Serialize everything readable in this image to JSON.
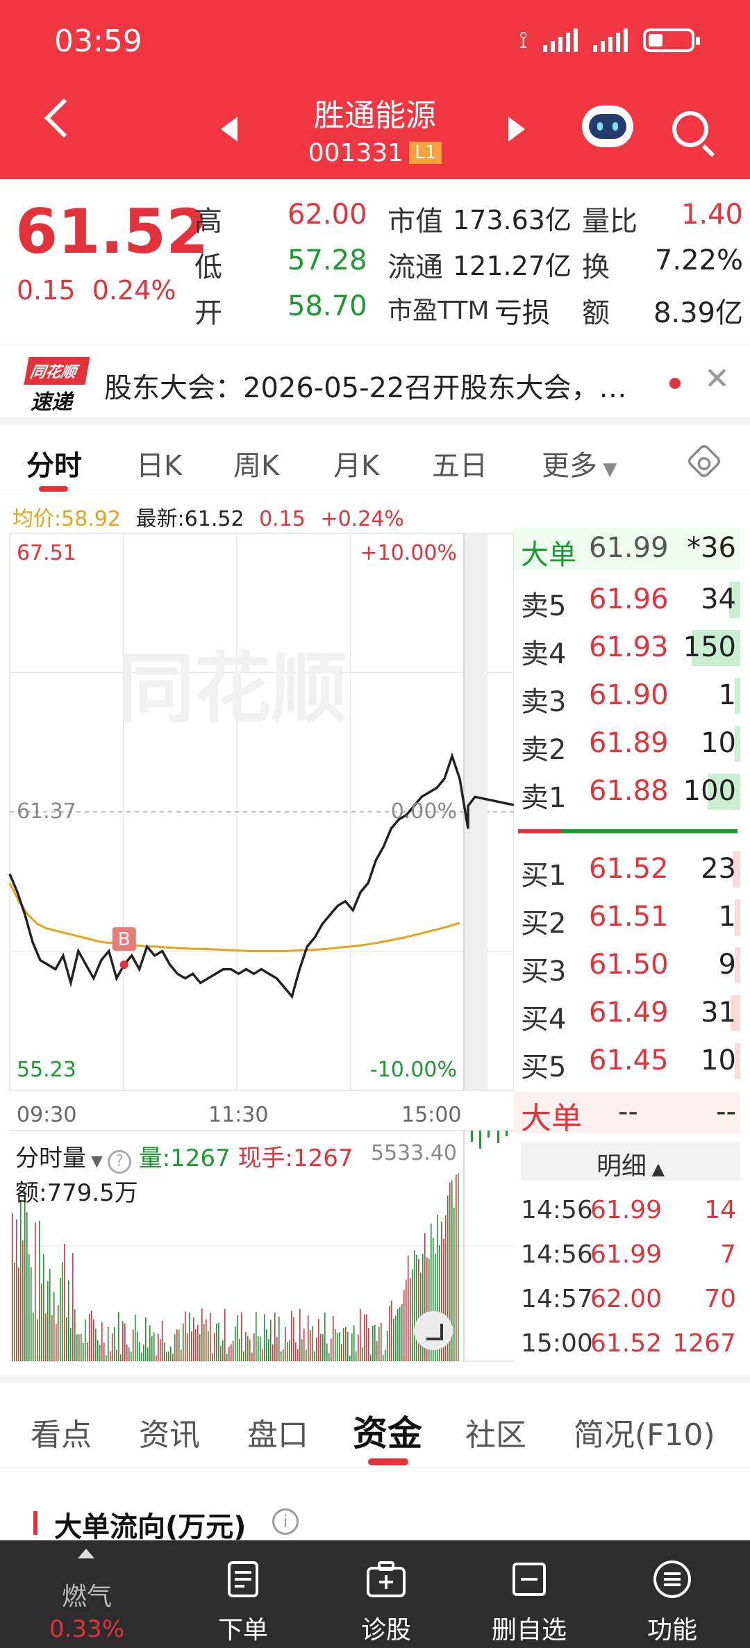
{
  "status": {
    "time": "03:59"
  },
  "header": {
    "stock_name": "胜通能源",
    "stock_code": "001331",
    "level_badge": "L1"
  },
  "quote": {
    "last_price": "61.52",
    "change": "0.15",
    "change_pct": "0.24%",
    "high_label": "高",
    "high": "62.00",
    "low_label": "低",
    "low": "57.28",
    "open_label": "开",
    "open": "58.70",
    "mcap_label": "市值",
    "mcap": "173.63亿",
    "float_label": "流通",
    "float": "121.27亿",
    "pe_label": "市盈TTM",
    "pe": "亏损",
    "vol_ratio_label": "量比",
    "vol_ratio": "1.40",
    "turnover_label": "换",
    "turnover": "7.22%",
    "amount_label": "额",
    "amount": "8.39亿"
  },
  "announcement": {
    "logo_top": "同花顺",
    "logo_bottom": "速递",
    "text": "股东大会：2026-05-22召开股东大会，…"
  },
  "period_tabs": [
    "分时",
    "日K",
    "周K",
    "月K",
    "五日",
    "更多"
  ],
  "chart_info": {
    "avg": "均价:58.92",
    "latest": "最新:61.52",
    "chg": "0.15",
    "chg_pct": "+0.24%"
  },
  "chart_data": {
    "type": "line",
    "title": "",
    "y_labels": {
      "top": "67.51",
      "mid": "61.37",
      "bottom": "55.23",
      "top_pct": "+10.00%",
      "mid_pct": "0.00%",
      "bottom_pct": "-10.00%"
    },
    "x_labels": [
      "09:30",
      "11:30",
      "15:00"
    ],
    "ylim": [
      55.23,
      67.51
    ],
    "prev_close": 61.37,
    "buy_marker": "B",
    "series": [
      {
        "name": "最新",
        "color": "#222222",
        "values": [
          60.0,
          59.6,
          59.1,
          58.5,
          58.1,
          58.0,
          57.9,
          58.2,
          57.6,
          58.3,
          58.0,
          57.7,
          58.1,
          58.3,
          57.7,
          58.0,
          58.2,
          57.9,
          58.4,
          58.2,
          58.3,
          58.0,
          57.8,
          57.7,
          57.8,
          57.6,
          57.7,
          57.8,
          57.9,
          57.9,
          57.8,
          57.9,
          57.8,
          57.9,
          57.8,
          57.7,
          57.5,
          57.3,
          57.9,
          58.4,
          58.6,
          58.9,
          59.1,
          59.3,
          59.4,
          59.2,
          59.6,
          59.8,
          60.3,
          60.6,
          61.0,
          61.2,
          61.3,
          61.5,
          61.7,
          61.8,
          61.9,
          62.1,
          62.6,
          62.1,
          61.0,
          61.5,
          61.7,
          61.52
        ]
      },
      {
        "name": "均价",
        "color": "#e6a317",
        "values": [
          59.8,
          59.4,
          59.1,
          58.9,
          58.8,
          58.75,
          58.7,
          58.65,
          58.6,
          58.55,
          58.5,
          58.48,
          58.46,
          58.44,
          58.42,
          58.4,
          58.4,
          58.38,
          58.37,
          58.36,
          58.35,
          58.35,
          58.34,
          58.33,
          58.32,
          58.31,
          58.3,
          58.3,
          58.3,
          58.3,
          58.3,
          58.31,
          58.32,
          58.33,
          58.34,
          58.36,
          58.38,
          58.4,
          58.42,
          58.45,
          58.48,
          58.52,
          58.56,
          58.6,
          58.65,
          58.7,
          58.75,
          58.8,
          58.86,
          58.92
        ]
      }
    ],
    "volume": {
      "title": "分时量",
      "vol_label": "量:1267",
      "hand_label": "现手:1267",
      "max_label": "5533.40",
      "amount_label": "额:779.5万"
    }
  },
  "order_book": {
    "big_top": {
      "label": "大单",
      "price": "61.99",
      "vol": "*36"
    },
    "asks": [
      {
        "label": "卖5",
        "price": "61.96",
        "vol": "34"
      },
      {
        "label": "卖4",
        "price": "61.93",
        "vol": "150"
      },
      {
        "label": "卖3",
        "price": "61.90",
        "vol": "1"
      },
      {
        "label": "卖2",
        "price": "61.89",
        "vol": "10"
      },
      {
        "label": "卖1",
        "price": "61.88",
        "vol": "100"
      }
    ],
    "bids": [
      {
        "label": "买1",
        "price": "61.52",
        "vol": "23"
      },
      {
        "label": "买2",
        "price": "61.51",
        "vol": "1"
      },
      {
        "label": "买3",
        "price": "61.50",
        "vol": "9"
      },
      {
        "label": "买4",
        "price": "61.49",
        "vol": "31"
      },
      {
        "label": "买5",
        "price": "61.45",
        "vol": "10"
      }
    ],
    "big_bottom": {
      "label": "大单",
      "price": "--",
      "vol": "--"
    },
    "detail_label": "明细",
    "trades": [
      {
        "time": "14:56",
        "price": "61.99",
        "vol": "14"
      },
      {
        "time": "14:56",
        "price": "61.99",
        "vol": "7"
      },
      {
        "time": "14:57",
        "price": "62.00",
        "vol": "70"
      },
      {
        "time": "15:00",
        "price": "61.52",
        "vol": "1267"
      }
    ]
  },
  "section_tabs": [
    "看点",
    "资讯",
    "盘口",
    "资金",
    "社区",
    "简况(F10)"
  ],
  "flow_title": "大单流向(万元)",
  "bottom_bar": {
    "sector_name": "燃气",
    "sector_change": "0.33%",
    "items": [
      "下单",
      "诊股",
      "删自选",
      "功能"
    ]
  }
}
